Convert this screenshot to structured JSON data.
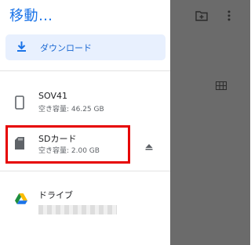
{
  "dialog": {
    "title": "移動…"
  },
  "downloads": {
    "label": "ダウンロード",
    "icon": "download-icon",
    "accent": "#1a73e8"
  },
  "storage": [
    {
      "name": "SOV41",
      "free_space": "空き容量: 46.25 GB",
      "icon": "phone-icon"
    },
    {
      "name": "SDカード",
      "free_space": "空き容量: 2.00 GB",
      "icon": "sd-card-icon",
      "highlighted": true
    }
  ],
  "cloud": [
    {
      "name": "ドライブ",
      "icon": "google-drive-icon"
    }
  ],
  "colors": {
    "highlight_border": "#e60000",
    "scrim": "#6b6b6b",
    "title": "#1a73e8"
  }
}
